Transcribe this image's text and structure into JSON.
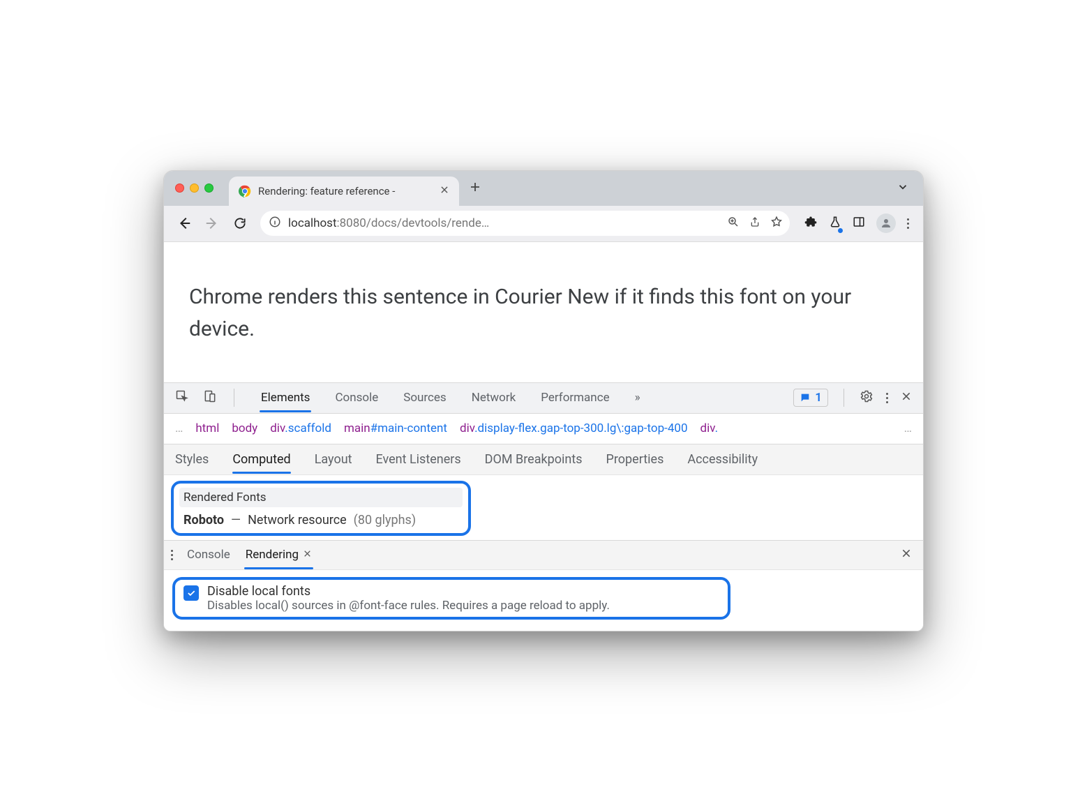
{
  "tab": {
    "title": "Rendering: feature reference -"
  },
  "address": {
    "host": "localhost",
    "port": ":8080",
    "path": "/docs/devtools/rende…"
  },
  "page": {
    "sentence": "Chrome renders this sentence in Courier New if it finds this font on your device."
  },
  "devtools": {
    "tabs": [
      "Elements",
      "Console",
      "Sources",
      "Network",
      "Performance"
    ],
    "more": "»",
    "messages": "1",
    "crumbs": {
      "ellipsis": "…",
      "items": [
        {
          "tag": "html"
        },
        {
          "tag": "body"
        },
        {
          "tag": "div",
          "cls": ".scaffold"
        },
        {
          "tag": "main",
          "id": "#main-content"
        },
        {
          "tag": "div",
          "cls": ".display-flex.gap-top-300.lg\\:gap-top-400"
        },
        {
          "tag": "div",
          "cls": "."
        }
      ],
      "trailing": "…"
    },
    "subtabs": [
      "Styles",
      "Computed",
      "Layout",
      "Event Listeners",
      "DOM Breakpoints",
      "Properties",
      "Accessibility"
    ],
    "rendered_fonts": {
      "header": "Rendered Fonts",
      "family": "Roboto",
      "source": "Network resource",
      "glyphs": "(80 glyphs)"
    },
    "drawer": {
      "tabs": [
        "Console",
        "Rendering"
      ],
      "option": {
        "title": "Disable local fonts",
        "desc": "Disables local() sources in @font-face rules. Requires a page reload to apply."
      }
    }
  }
}
